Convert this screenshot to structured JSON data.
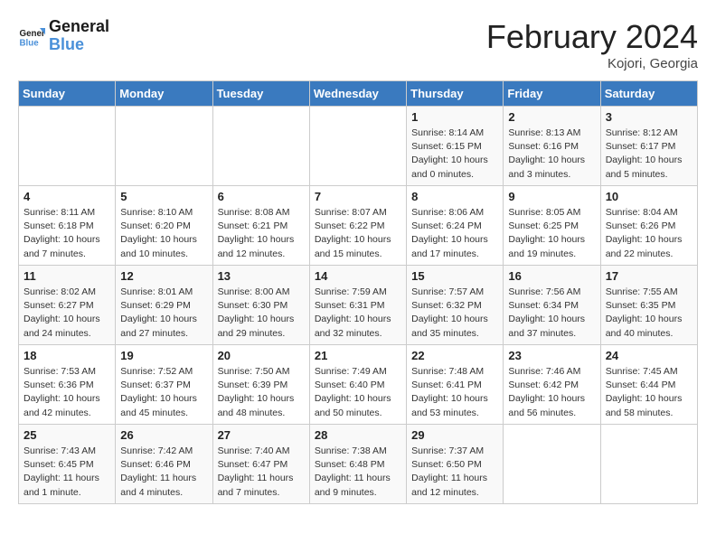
{
  "header": {
    "logo_line1": "General",
    "logo_line2": "Blue",
    "month_title": "February 2024",
    "location": "Kojori, Georgia"
  },
  "weekdays": [
    "Sunday",
    "Monday",
    "Tuesday",
    "Wednesday",
    "Thursday",
    "Friday",
    "Saturday"
  ],
  "weeks": [
    [
      {
        "day": "",
        "info": ""
      },
      {
        "day": "",
        "info": ""
      },
      {
        "day": "",
        "info": ""
      },
      {
        "day": "",
        "info": ""
      },
      {
        "day": "1",
        "info": "Sunrise: 8:14 AM\nSunset: 6:15 PM\nDaylight: 10 hours\nand 0 minutes."
      },
      {
        "day": "2",
        "info": "Sunrise: 8:13 AM\nSunset: 6:16 PM\nDaylight: 10 hours\nand 3 minutes."
      },
      {
        "day": "3",
        "info": "Sunrise: 8:12 AM\nSunset: 6:17 PM\nDaylight: 10 hours\nand 5 minutes."
      }
    ],
    [
      {
        "day": "4",
        "info": "Sunrise: 8:11 AM\nSunset: 6:18 PM\nDaylight: 10 hours\nand 7 minutes."
      },
      {
        "day": "5",
        "info": "Sunrise: 8:10 AM\nSunset: 6:20 PM\nDaylight: 10 hours\nand 10 minutes."
      },
      {
        "day": "6",
        "info": "Sunrise: 8:08 AM\nSunset: 6:21 PM\nDaylight: 10 hours\nand 12 minutes."
      },
      {
        "day": "7",
        "info": "Sunrise: 8:07 AM\nSunset: 6:22 PM\nDaylight: 10 hours\nand 15 minutes."
      },
      {
        "day": "8",
        "info": "Sunrise: 8:06 AM\nSunset: 6:24 PM\nDaylight: 10 hours\nand 17 minutes."
      },
      {
        "day": "9",
        "info": "Sunrise: 8:05 AM\nSunset: 6:25 PM\nDaylight: 10 hours\nand 19 minutes."
      },
      {
        "day": "10",
        "info": "Sunrise: 8:04 AM\nSunset: 6:26 PM\nDaylight: 10 hours\nand 22 minutes."
      }
    ],
    [
      {
        "day": "11",
        "info": "Sunrise: 8:02 AM\nSunset: 6:27 PM\nDaylight: 10 hours\nand 24 minutes."
      },
      {
        "day": "12",
        "info": "Sunrise: 8:01 AM\nSunset: 6:29 PM\nDaylight: 10 hours\nand 27 minutes."
      },
      {
        "day": "13",
        "info": "Sunrise: 8:00 AM\nSunset: 6:30 PM\nDaylight: 10 hours\nand 29 minutes."
      },
      {
        "day": "14",
        "info": "Sunrise: 7:59 AM\nSunset: 6:31 PM\nDaylight: 10 hours\nand 32 minutes."
      },
      {
        "day": "15",
        "info": "Sunrise: 7:57 AM\nSunset: 6:32 PM\nDaylight: 10 hours\nand 35 minutes."
      },
      {
        "day": "16",
        "info": "Sunrise: 7:56 AM\nSunset: 6:34 PM\nDaylight: 10 hours\nand 37 minutes."
      },
      {
        "day": "17",
        "info": "Sunrise: 7:55 AM\nSunset: 6:35 PM\nDaylight: 10 hours\nand 40 minutes."
      }
    ],
    [
      {
        "day": "18",
        "info": "Sunrise: 7:53 AM\nSunset: 6:36 PM\nDaylight: 10 hours\nand 42 minutes."
      },
      {
        "day": "19",
        "info": "Sunrise: 7:52 AM\nSunset: 6:37 PM\nDaylight: 10 hours\nand 45 minutes."
      },
      {
        "day": "20",
        "info": "Sunrise: 7:50 AM\nSunset: 6:39 PM\nDaylight: 10 hours\nand 48 minutes."
      },
      {
        "day": "21",
        "info": "Sunrise: 7:49 AM\nSunset: 6:40 PM\nDaylight: 10 hours\nand 50 minutes."
      },
      {
        "day": "22",
        "info": "Sunrise: 7:48 AM\nSunset: 6:41 PM\nDaylight: 10 hours\nand 53 minutes."
      },
      {
        "day": "23",
        "info": "Sunrise: 7:46 AM\nSunset: 6:42 PM\nDaylight: 10 hours\nand 56 minutes."
      },
      {
        "day": "24",
        "info": "Sunrise: 7:45 AM\nSunset: 6:44 PM\nDaylight: 10 hours\nand 58 minutes."
      }
    ],
    [
      {
        "day": "25",
        "info": "Sunrise: 7:43 AM\nSunset: 6:45 PM\nDaylight: 11 hours\nand 1 minute."
      },
      {
        "day": "26",
        "info": "Sunrise: 7:42 AM\nSunset: 6:46 PM\nDaylight: 11 hours\nand 4 minutes."
      },
      {
        "day": "27",
        "info": "Sunrise: 7:40 AM\nSunset: 6:47 PM\nDaylight: 11 hours\nand 7 minutes."
      },
      {
        "day": "28",
        "info": "Sunrise: 7:38 AM\nSunset: 6:48 PM\nDaylight: 11 hours\nand 9 minutes."
      },
      {
        "day": "29",
        "info": "Sunrise: 7:37 AM\nSunset: 6:50 PM\nDaylight: 11 hours\nand 12 minutes."
      },
      {
        "day": "",
        "info": ""
      },
      {
        "day": "",
        "info": ""
      }
    ]
  ]
}
